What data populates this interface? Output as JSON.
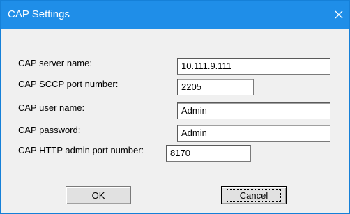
{
  "window": {
    "title": "CAP Settings",
    "close_icon": "close-icon",
    "titlebar_color": "#1f8ee8"
  },
  "fields": [
    {
      "label": "CAP server name:",
      "value": "10.111.9.111"
    },
    {
      "label": "CAP SCCP port number:",
      "value": "2205"
    },
    {
      "label": "CAP user name:",
      "value": "Admin"
    },
    {
      "label": "CAP password:",
      "value": "Admin"
    },
    {
      "label": "CAP HTTP admin port number:",
      "value": "8170"
    }
  ],
  "buttons": {
    "ok_label": "OK",
    "cancel_label": "Cancel"
  }
}
